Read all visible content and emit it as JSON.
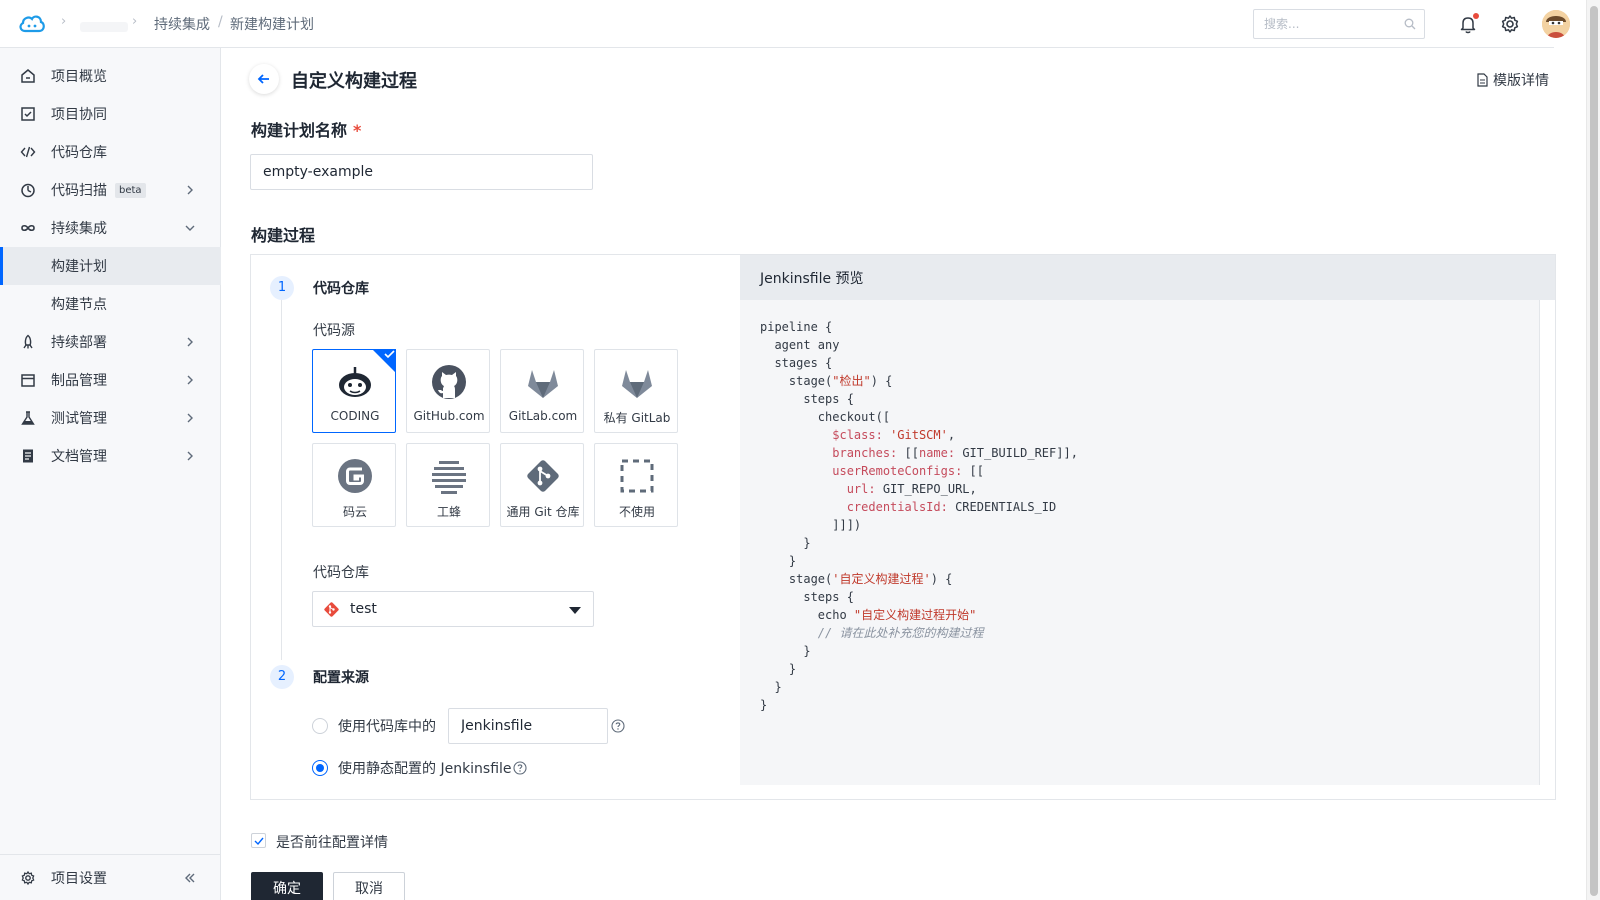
{
  "breadcrumb": {
    "parent": "持续集成",
    "separator": "/",
    "current": "新建构建计划"
  },
  "search": {
    "placeholder": "搜索..."
  },
  "sidebar": {
    "items": [
      {
        "label": "项目概览",
        "icon": "home-icon"
      },
      {
        "label": "项目协同",
        "icon": "check-square-icon"
      },
      {
        "label": "代码仓库",
        "icon": "code-icon"
      },
      {
        "label": "代码扫描",
        "icon": "scan-icon",
        "badge": "beta"
      },
      {
        "label": "持续集成",
        "icon": "infinity-icon"
      },
      {
        "label": "构建计划"
      },
      {
        "label": "构建节点"
      },
      {
        "label": "持续部署",
        "icon": "rocket-icon"
      },
      {
        "label": "制品管理",
        "icon": "box-icon"
      },
      {
        "label": "测试管理",
        "icon": "flask-icon"
      },
      {
        "label": "文档管理",
        "icon": "doc-icon"
      }
    ],
    "footer": {
      "label": "项目设置"
    }
  },
  "header": {
    "title": "自定义构建过程",
    "template_link": "模版详情"
  },
  "form": {
    "name_label": "构建计划名称",
    "required_mark": "*",
    "name_value": "empty-example",
    "process_label": "构建过程"
  },
  "step1": {
    "number": "1",
    "title": "代码仓库",
    "source_label": "代码源",
    "sources": [
      {
        "label": "CODING",
        "icon": "coding-icon",
        "selected": true
      },
      {
        "label": "GitHub.com",
        "icon": "github-icon"
      },
      {
        "label": "GitLab.com",
        "icon": "gitlab-icon"
      },
      {
        "label": "私有 GitLab",
        "icon": "gitlab-private-icon"
      },
      {
        "label": "码云",
        "icon": "gitee-icon"
      },
      {
        "label": "工蜂",
        "icon": "gongfeng-icon"
      },
      {
        "label": "通用 Git 仓库",
        "icon": "git-icon"
      },
      {
        "label": "不使用",
        "icon": "none-icon"
      }
    ],
    "repo_label": "代码仓库",
    "repo_value": "test"
  },
  "step2": {
    "number": "2",
    "title": "配置来源",
    "option1_label": "使用代码库中的",
    "option1_value": "Jenkinsfile",
    "option2_label": "使用静态配置的 Jenkinsfile",
    "selected": "option2"
  },
  "preview": {
    "title": "Jenkinsfile 预览",
    "code": [
      "pipeline {",
      "  agent any",
      "  stages {",
      "    stage(\"检出\") {",
      "      steps {",
      "        checkout([",
      "          $class: 'GitSCM',",
      "          branches: [[name: GIT_BUILD_REF]],",
      "          userRemoteConfigs: [[",
      "            url: GIT_REPO_URL,",
      "            credentialsId: CREDENTIALS_ID",
      "          ]]])",
      "      }",
      "    }",
      "    stage('自定义构建过程') {",
      "      steps {",
      "        echo \"自定义构建过程开始\"",
      "        // 请在此处补充您的构建过程",
      "      }",
      "    }",
      "  }",
      "}"
    ]
  },
  "footer_form": {
    "checkbox_label": "是否前往配置详情",
    "checkbox_checked": true,
    "confirm_label": "确定",
    "cancel_label": "取消"
  },
  "colors": {
    "accent": "#0066ff",
    "primary_button": "#1f2733",
    "required": "#e84b3c"
  }
}
